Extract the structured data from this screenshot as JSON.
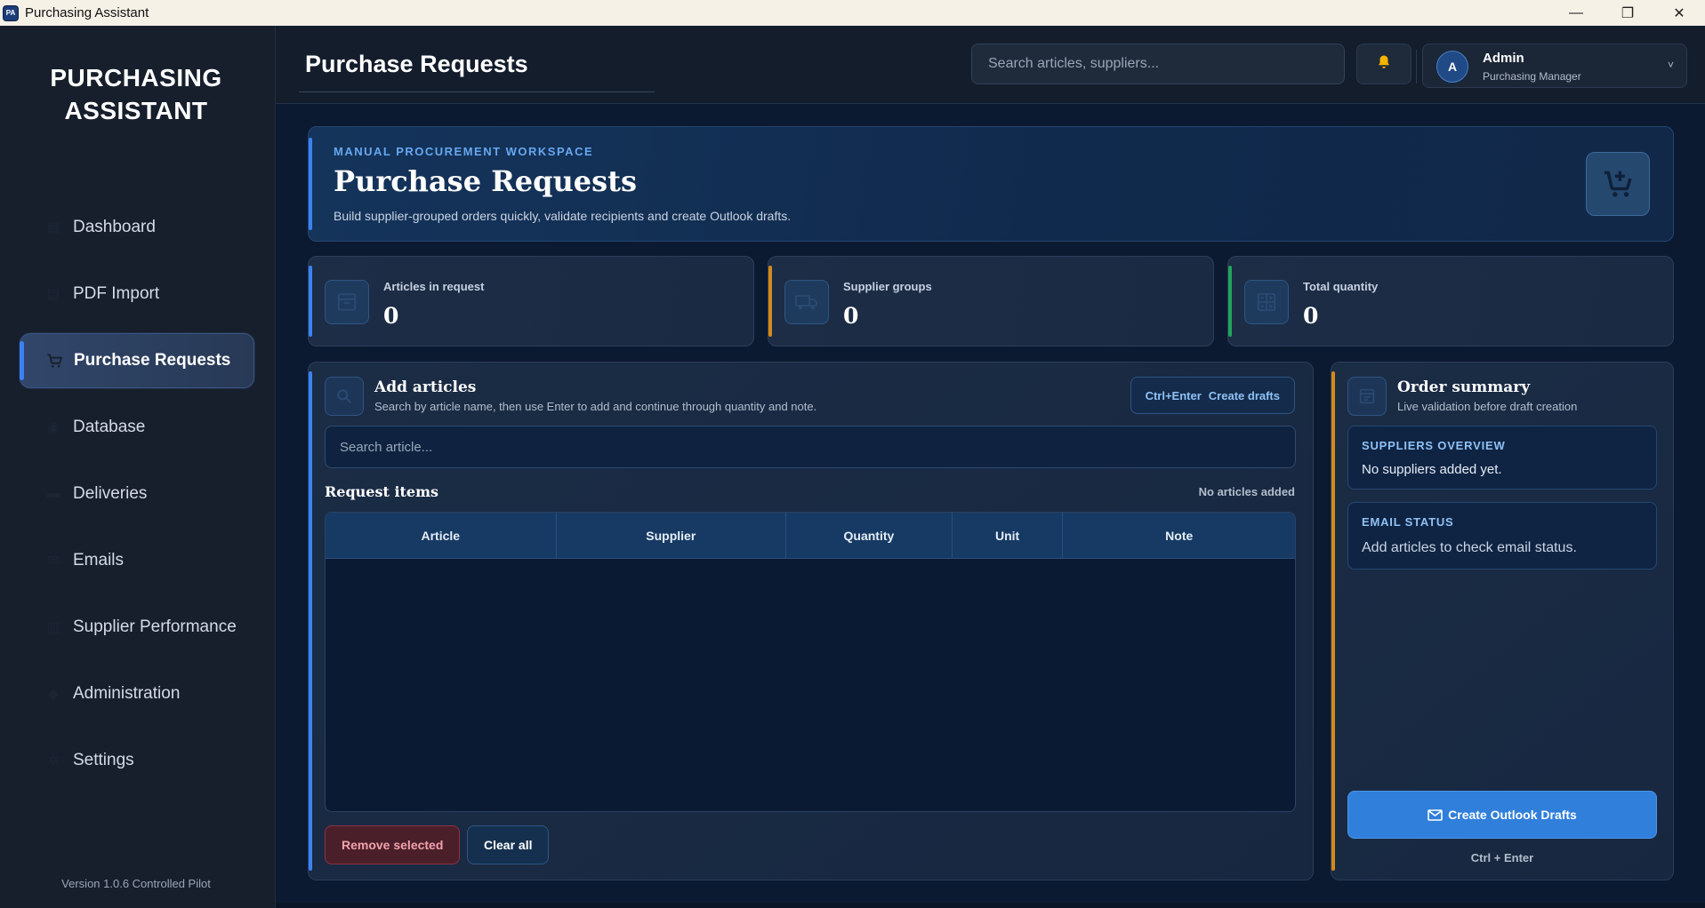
{
  "window": {
    "title": "Purchasing Assistant",
    "minimize_glyph": "—",
    "restore_glyph": "❐",
    "close_glyph": "✕"
  },
  "sidebar": {
    "brand_line1": "PURCHASING",
    "brand_line2": "ASSISTANT",
    "items": [
      {
        "label": "Dashboard",
        "icon": "dashboard-icon"
      },
      {
        "label": "PDF Import",
        "icon": "pdf-icon"
      },
      {
        "label": "Purchase Requests",
        "icon": "cart-icon",
        "active": true
      },
      {
        "label": "Database",
        "icon": "database-icon"
      },
      {
        "label": "Deliveries",
        "icon": "truck-icon"
      },
      {
        "label": "Emails",
        "icon": "mail-icon"
      },
      {
        "label": "Supplier Performance",
        "icon": "chart-icon"
      },
      {
        "label": "Administration",
        "icon": "admin-icon"
      },
      {
        "label": "Settings",
        "icon": "gear-icon"
      }
    ],
    "version": "Version 1.0.6 Controlled Pilot"
  },
  "header": {
    "title": "Purchase Requests",
    "search_placeholder": "Search articles, suppliers...",
    "user": {
      "initial": "A",
      "name": "Admin",
      "role": "Purchasing Manager",
      "chevron": "˅"
    }
  },
  "hero": {
    "eyebrow": "MANUAL PROCUREMENT WORKSPACE",
    "title": "Purchase Requests",
    "subtitle": "Build supplier-grouped orders quickly, validate recipients and create Outlook drafts."
  },
  "stats": [
    {
      "label": "Articles in request",
      "value": "0"
    },
    {
      "label": "Supplier groups",
      "value": "0"
    },
    {
      "label": "Total quantity",
      "value": "0"
    }
  ],
  "add_articles": {
    "title": "Add articles",
    "subtitle": "Search by article name, then use Enter to add and continue through quantity and note.",
    "shortcut_key": "Ctrl+Enter",
    "shortcut_label": "Create drafts",
    "search_placeholder": "Search article...",
    "items_label": "Request items",
    "items_hint": "No articles added",
    "columns": [
      "Article",
      "Supplier",
      "Quantity",
      "Unit",
      "Note"
    ],
    "remove_label": "Remove selected",
    "clear_label": "Clear all"
  },
  "summary": {
    "title": "Order summary",
    "subtitle": "Live validation before draft creation",
    "suppliers_title": "SUPPLIERS OVERVIEW",
    "suppliers_text": "No suppliers added yet.",
    "email_title": "EMAIL STATUS",
    "email_text": "Add articles to check email status.",
    "drafts_button": "Create Outlook Drafts",
    "drafts_hint": "Ctrl + Enter"
  },
  "colors": {
    "accent": "#3b82f6",
    "warning": "#d48a1a",
    "success": "#22a35a",
    "primary_button": "#2f7fdb"
  }
}
